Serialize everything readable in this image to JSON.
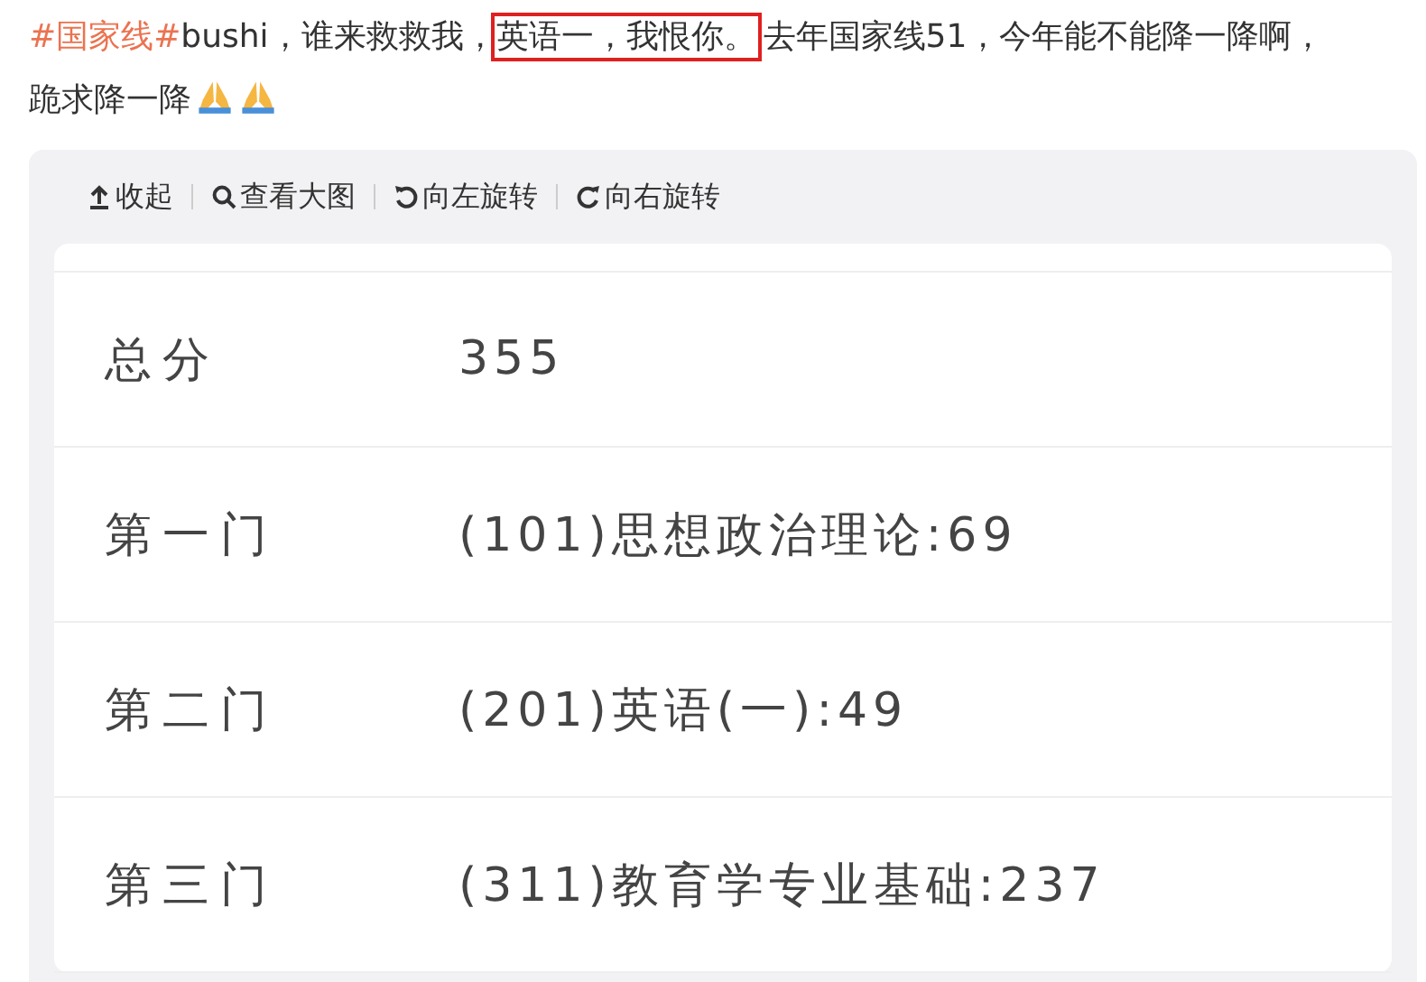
{
  "post": {
    "segments": [
      {
        "kind": "hashtag",
        "text": "#国家线#"
      },
      {
        "kind": "text",
        "text": "bushi，谁来救救我，"
      },
      {
        "kind": "boxed",
        "text": "英语一，我恨你。"
      },
      {
        "kind": "text",
        "text": "去年国家线51，今年能不能降一降啊，跪求降一降"
      }
    ]
  },
  "toolbar": [
    "收起",
    "查看大图",
    "向左旋转",
    "向右旋转"
  ],
  "scores": [
    {
      "label": "总分",
      "value": "355"
    },
    {
      "label": "第一门",
      "value": "(101)思想政治理论:69"
    },
    {
      "label": "第二门",
      "value": "(201)英语(一):49"
    },
    {
      "label": "第三门",
      "value": "(311)教育学专业基础:237"
    }
  ]
}
